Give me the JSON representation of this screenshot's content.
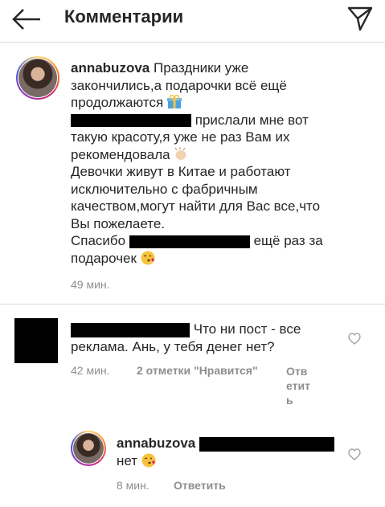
{
  "header": {
    "title": "Комментарии"
  },
  "caption": {
    "username": "annabuzova",
    "line1": "Праздники уже",
    "line2": "закончились,а подарочки всё ещё",
    "line3": "продолжаются",
    "line4_after_redaction": "прислали мне вот",
    "line5": "такую красоту,я уже не раз Вам их",
    "line6": "рекомендовала",
    "line7": "Девочки живут в Китае и работают",
    "line8": "исключительно с фабричным",
    "line9": "качеством,могут найти для Вас все,что",
    "line10": "Вы пожелаете.",
    "line11_start": "Спасибо",
    "line11_end": "ещё раз за",
    "line12": "подарочек",
    "time": "49 мин."
  },
  "comment": {
    "line1": "Что ни пост - все",
    "line2": "реклама. Ань, у тебя денег нет?",
    "time": "42 мин.",
    "likes": "2 отметки \"Нравится\"",
    "reply_parts": [
      "Отв",
      "етит",
      "ь"
    ]
  },
  "reply": {
    "username": "annabuzova",
    "text": "нет",
    "time": "8 мин.",
    "reply_label": "Ответить"
  },
  "icons": {
    "back": "arrow-left-icon",
    "send": "paper-plane-icon",
    "heart": "heart-outline-icon",
    "gift": "gift-emoji",
    "clap": "clapping-hands-emoji",
    "kiss": "kissing-face-emoji"
  }
}
